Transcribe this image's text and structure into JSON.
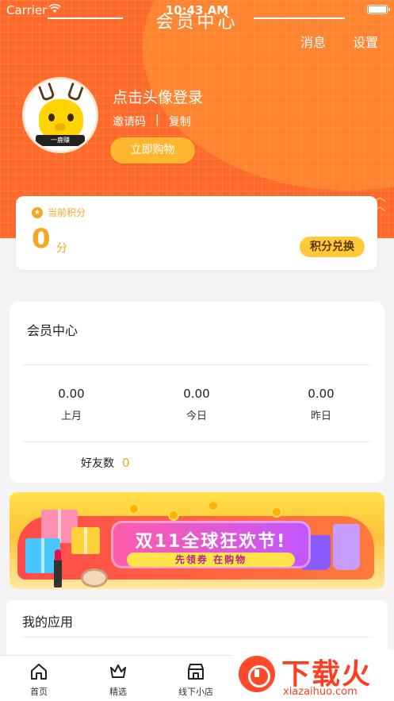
{
  "status_bar": {
    "carrier": "Carrier",
    "time": "10:43 AM"
  },
  "header": {
    "title": "会员中心",
    "messages_label": "消息",
    "settings_label": "设置"
  },
  "profile": {
    "avatar_text": "一鹿赚",
    "login_prompt": "点击头像登录",
    "invite_code_label": "邀请码",
    "separator": "|",
    "copy_label": "复制",
    "buy_button": "立即购物"
  },
  "points": {
    "label": "当前积分",
    "value": "0",
    "unit": "分",
    "redeem_button": "积分兑换"
  },
  "member_center": {
    "title": "会员中心",
    "stats": [
      {
        "value": "0.00",
        "label": "上月"
      },
      {
        "value": "0.00",
        "label": "今日"
      },
      {
        "value": "0.00",
        "label": "昨日"
      }
    ],
    "friends_label": "好友数",
    "friends_count": "0"
  },
  "banner": {
    "title": "双11全球狂欢节!",
    "subtitle": "先领券 在购物"
  },
  "my_apps": {
    "title": "我的应用"
  },
  "tabbar": {
    "tabs": [
      {
        "label": "首页",
        "icon": "home-icon"
      },
      {
        "label": "精选",
        "icon": "crown-icon"
      },
      {
        "label": "线下小店",
        "icon": "store-icon"
      }
    ]
  },
  "watermark": {
    "brand_cn": "下载火",
    "brand_en": "xiazaihuo.com"
  },
  "colors": {
    "brand_orange": "#ff6a2a",
    "accent_yellow": "#ffb52e",
    "points_orange": "#f5a623"
  }
}
